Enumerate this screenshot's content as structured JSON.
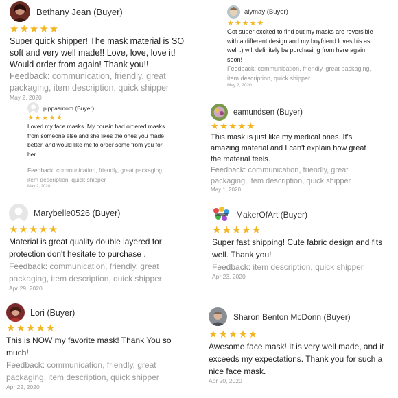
{
  "reviews": [
    {
      "name": "Bethany Jean (Buyer)",
      "stars": "★★★★★",
      "text": "Super quick shipper! The mask material is SO soft and very well made!! Love, love, love it! Would order from again! Thank you!!",
      "feedback_label": "Feedback:",
      "feedback": "communication, friendly, great packaging, item description, quick shipper",
      "date": "May 2, 2020"
    },
    {
      "name": "alymay (Buyer)",
      "stars": "★★★★★",
      "text": "Got super excited to find out my masks are reversible with a different design and my boyfriend loves his as well :) will definitely be purchasing from here again soon!",
      "feedback_label": "Feedback:",
      "feedback": "communication, friendly, great packaging, item description, quick shipper",
      "date": "May 2, 2020"
    },
    {
      "name": "pippasmom (Buyer)",
      "stars": "★★★★★",
      "text": "Loved my face masks. My cousin had ordered masks  from someone else and she likes the ones  you made better, and would like me to order some from you for her.",
      "feedback_label": "Feedback:",
      "feedback": "communication, friendly, great packaging, item description, quick shipper",
      "date": "May 2, 2020"
    },
    {
      "name": "eamundsen (Buyer)",
      "stars": "★★★★★",
      "text": "This mask is just like my medical ones. It's amazing material and I can't explain how great the material feels.",
      "feedback_label": "Feedback:",
      "feedback": "communication, friendly, great packaging, item description, quick shipper",
      "date": "May 1, 2020"
    },
    {
      "name": "Marybelle0526 (Buyer)",
      "stars": "★★★★★",
      "text": "Material is great quality double layered for protection don't hesitate to purchase .",
      "feedback_label": "Feedback:",
      "feedback": "communication, friendly, great packaging, item description, quick shipper",
      "date": "Apr 29, 2020"
    },
    {
      "name": "MakerOfArt (Buyer)",
      "stars": "★★★★★",
      "text": "Super fast shipping! Cute fabric design and fits well. Thank you!",
      "feedback_label": "Feedback:",
      "feedback": "item description, quick shipper",
      "date": "Apr 23, 2020"
    },
    {
      "name": "Lori (Buyer)",
      "stars": "★★★★★",
      "text": "This is NOW my favorite mask! Thank You so much!",
      "feedback_label": "Feedback:",
      "feedback": "communication, friendly, great packaging, item description, quick shipper",
      "date": "Apr 22, 2020"
    },
    {
      "name": "Sharon Benton McDonn (Buyer)",
      "stars": "★★★★★",
      "text": "Awesome face mask! It is very well made, and it exceeds my expectations. Thank you for such a nice face mask.",
      "feedback_label": "Feedback:",
      "feedback": "communication, friendly, great packaging, item description, quick shipper",
      "date": "Apr 20, 2020"
    }
  ],
  "colors": {
    "star": "#f3b623",
    "text": "#222222",
    "muted": "#9a9a9a"
  }
}
